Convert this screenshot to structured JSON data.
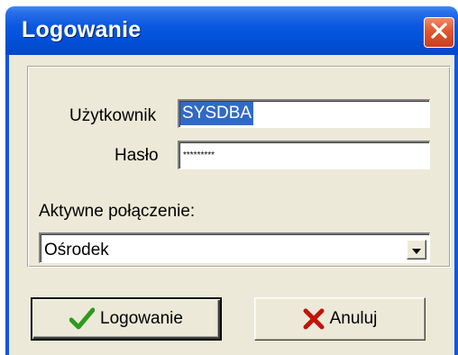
{
  "window": {
    "title": "Logowanie",
    "close_icon": "close-icon"
  },
  "form": {
    "user_label": "Użytkownik",
    "user_value": "SYSDBA",
    "password_label": "Hasło",
    "password_value": "*********",
    "connection_label": "Aktywne połączenie:",
    "connection_value": "Ośrodek"
  },
  "buttons": {
    "login_label": "Logowanie",
    "login_icon": "checkmark-icon",
    "cancel_label": "Anuluj",
    "cancel_icon": "x-icon"
  },
  "colors": {
    "titlebar": "#0a58e0",
    "selection": "#316ac5",
    "client_bg": "#ece9d8",
    "close_button": "#e0572e",
    "check_green": "#2f9a1c",
    "cancel_red": "#c0140c"
  }
}
